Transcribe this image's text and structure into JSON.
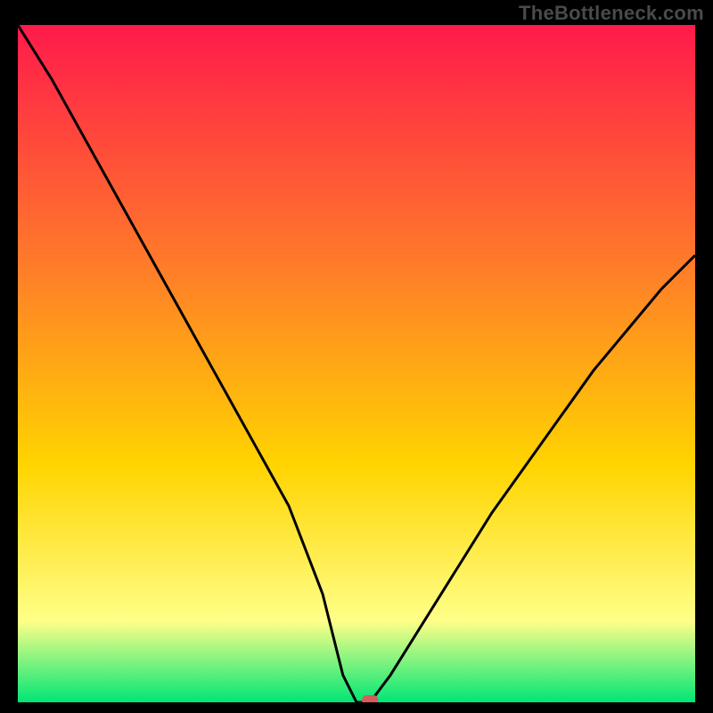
{
  "watermark": "TheBottleneck.com",
  "chart_data": {
    "type": "line",
    "title": "",
    "xlabel": "",
    "ylabel": "",
    "xlim": [
      0,
      100
    ],
    "ylim": [
      0,
      100
    ],
    "grid": false,
    "legend": false,
    "background_gradient": {
      "top": "#ff1a4b",
      "mid1": "#ff7a2a",
      "mid2": "#ffd400",
      "mid3": "#ffff88",
      "bottom": "#00e676"
    },
    "series": [
      {
        "name": "bottleneck-curve",
        "x": [
          0,
          5,
          10,
          15,
          20,
          25,
          30,
          35,
          40,
          45,
          48,
          50,
          52,
          55,
          60,
          65,
          70,
          75,
          80,
          85,
          90,
          95,
          100
        ],
        "y": [
          100,
          92,
          83,
          74,
          65,
          56,
          47,
          38,
          29,
          16,
          4,
          0,
          0,
          4,
          12,
          20,
          28,
          35,
          42,
          49,
          55,
          61,
          66
        ],
        "stroke": "#000000"
      }
    ],
    "marker": {
      "x": 52,
      "y": 0,
      "color": "#d85a5a",
      "shape": "rounded-rect"
    }
  }
}
